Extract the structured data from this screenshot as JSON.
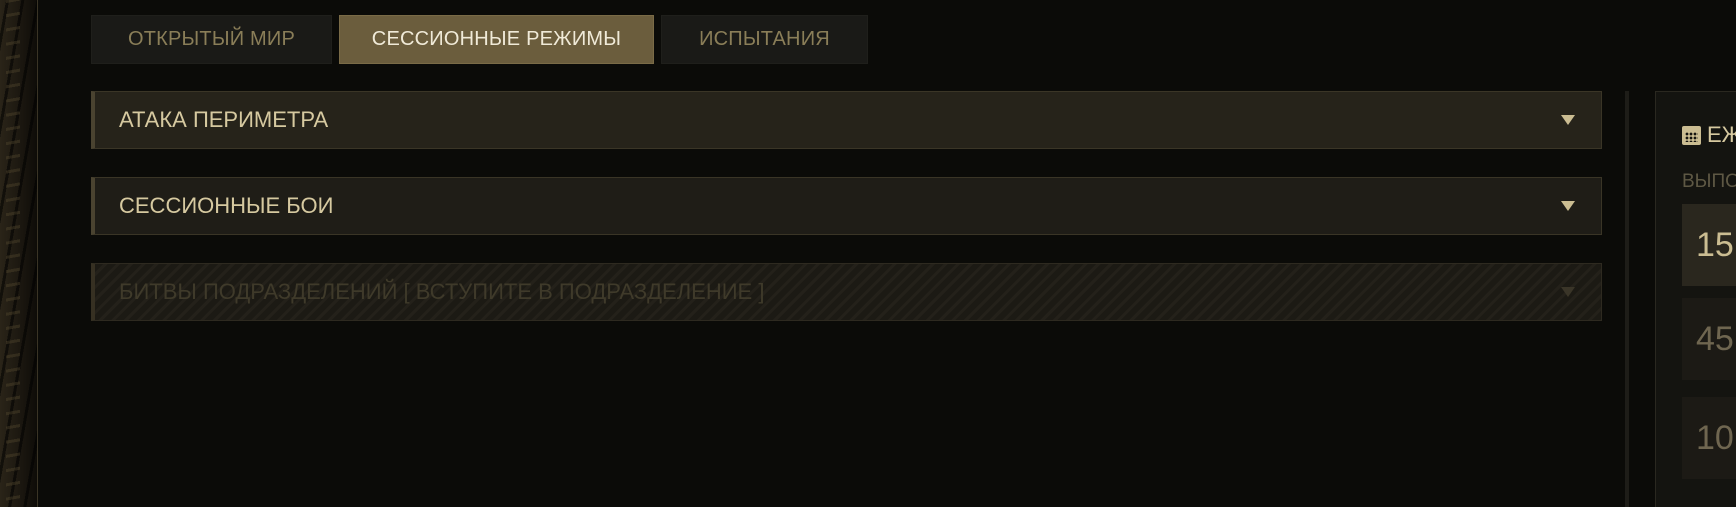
{
  "tabs": [
    {
      "label": "ОТКРЫТЫЙ МИР",
      "active": false
    },
    {
      "label": "СЕССИОННЫЕ РЕЖИМЫ",
      "active": true
    },
    {
      "label": "ИСПЫТАНИЯ",
      "active": false
    }
  ],
  "sections": [
    {
      "label": "АТАКА ПЕРИМЕТРА",
      "enabled": true
    },
    {
      "label": "СЕССИОННЫЕ БОИ",
      "enabled": true
    },
    {
      "label": "БИТВЫ ПОДРАЗДЕЛЕНИЙ [ ВСТУПИТЕ В ПОДРАЗДЕЛЕНИЕ ]",
      "enabled": false
    }
  ],
  "daily_panel": {
    "title": "ЕЖ",
    "subtitle": "ВЫПО",
    "icon": "calendar-icon",
    "rewards": [
      "15",
      "45",
      "10"
    ]
  },
  "colors": {
    "accent": "#cbbd92",
    "active_tab": "#6b5d3d",
    "background": "#0b0b08"
  }
}
